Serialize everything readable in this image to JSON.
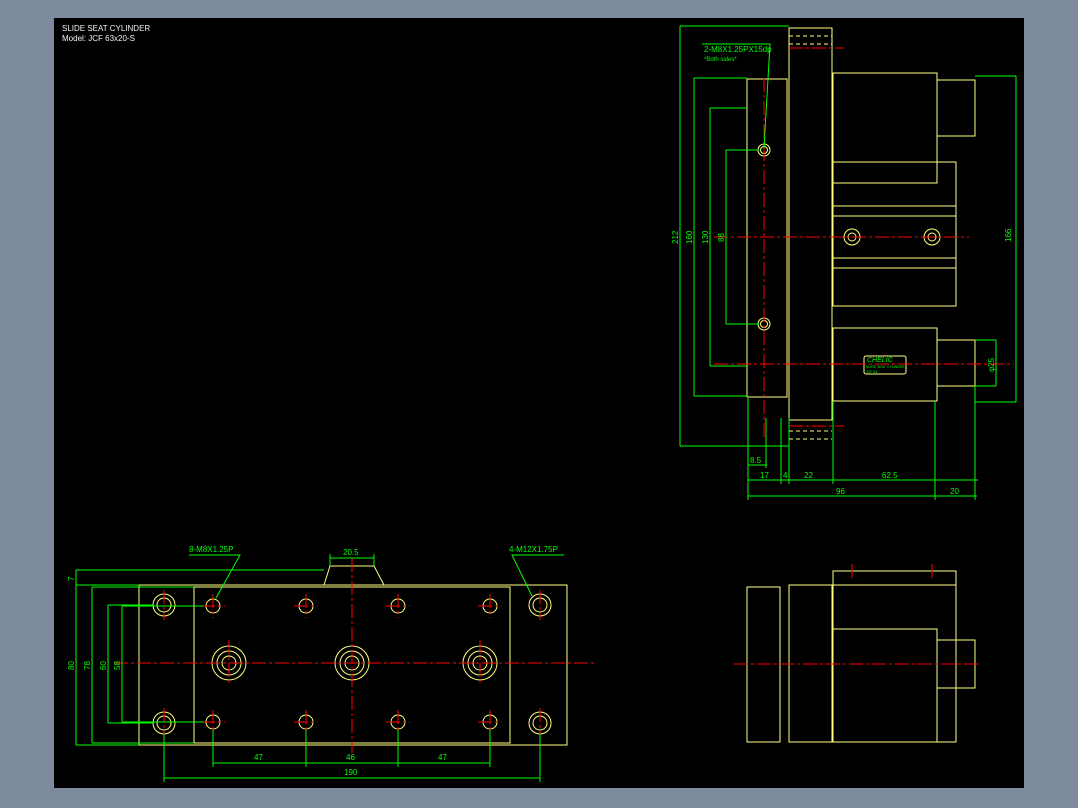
{
  "title": "SLIDE SEAT CYLINDER",
  "model": "Model: JCF 63x20-S",
  "colors": {
    "background": "#000000",
    "frame": "#7d8a9e",
    "outline": "#ffff80",
    "dimension": "#00ff00",
    "centerline": "#ff0000",
    "text": "#ffffff"
  },
  "side_view": {
    "callout": "2-M8X1.25PX15dp",
    "callout_note": "*Both sides*",
    "dims_vertical": [
      "212",
      "160",
      "130",
      "88",
      "166",
      "φ25"
    ],
    "dims_horizontal": [
      "8.5",
      "17",
      "4",
      "22",
      "62.5",
      "96",
      "20"
    ],
    "logo": "CHELIC",
    "label_line1": "SLIDE SEAT CYLINDER",
    "label_line2": "JCF 63"
  },
  "plan_view": {
    "callout_left": "8-M8X1.25P",
    "callout_right": "4-M12X1.75P",
    "dim_top": "20.5",
    "dims_vertical": [
      "7",
      "80",
      "78",
      "60",
      "58"
    ],
    "dims_horizontal": [
      "47",
      "46",
      "47",
      "190"
    ]
  }
}
